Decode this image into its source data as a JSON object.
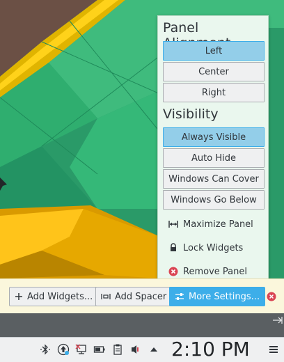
{
  "panel_settings": {
    "alignment_title": "Panel Alignment",
    "alignment_options": [
      {
        "label": "Left",
        "selected": true
      },
      {
        "label": "Center",
        "selected": false
      },
      {
        "label": "Right",
        "selected": false
      }
    ],
    "visibility_title": "Visibility",
    "visibility_options": [
      {
        "label": "Always Visible",
        "selected": true
      },
      {
        "label": "Auto Hide",
        "selected": false
      },
      {
        "label": "Windows Can Cover",
        "selected": false
      },
      {
        "label": "Windows Go Below",
        "selected": false
      }
    ],
    "actions": [
      {
        "label": "Maximize Panel",
        "icon": "maximize-icon"
      },
      {
        "label": "Lock Widgets",
        "icon": "lock-icon"
      },
      {
        "label": "Remove Panel",
        "icon": "remove-icon"
      }
    ]
  },
  "toolbar": {
    "add_widgets": "Add Widgets...",
    "add_spacer": "Add Spacer",
    "more_settings": "More Settings..."
  },
  "taskbar": {
    "clock": "2:10 PM",
    "tray_icons": [
      "bluetooth-icon",
      "updates-icon",
      "network-icon",
      "battery-icon",
      "clipboard-icon",
      "volume-muted-icon",
      "expand-tray-icon"
    ]
  },
  "colors": {
    "selected": "#93cee9",
    "accent": "#3daee9",
    "popup_bg": "#eaf7ee",
    "toolbar_bg": "#fbf7dc",
    "remove_red": "#da4453"
  }
}
